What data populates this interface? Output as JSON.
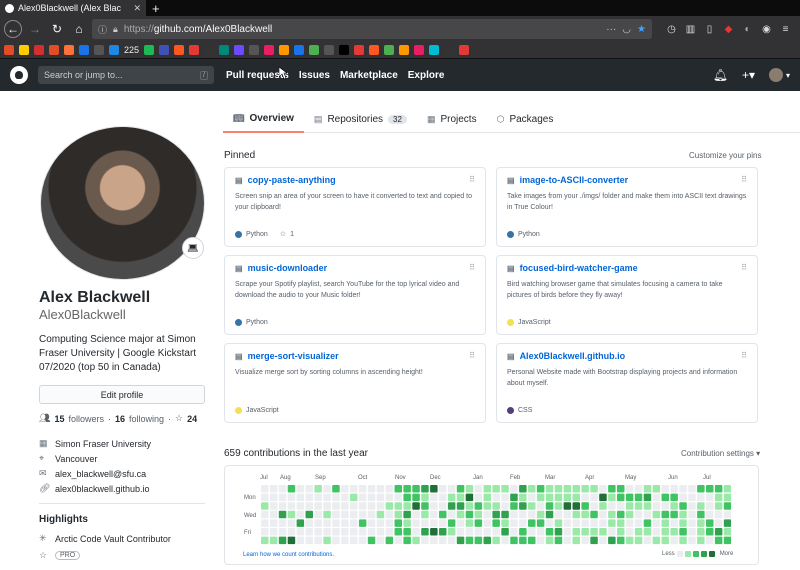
{
  "browser": {
    "tab_title": "Alex0Blackwell (Alex Blac",
    "url_scheme": "https://",
    "url_rest": "github.com/Alex0Blackwell",
    "bookmark_count": "225",
    "bookmark_colors": [
      "#e34c26",
      "#ffcc00",
      "#d32f2f",
      "#e34c26",
      "#ff7139",
      "#1a73e8",
      "#555",
      "#1e88e5",
      "#1db954",
      "#3f51b5",
      "#ff5722",
      "#e53935",
      "#333",
      "#00897b",
      "#6d4aff",
      "#555",
      "#e91e63",
      "#ff9800",
      "#1a73e8",
      "#4caf50",
      "#555",
      "#000",
      "#e53935",
      "#ff5722",
      "#4caf50",
      "#ff9800",
      "#e91e63",
      "#00bcd4",
      "#333",
      "#e53935"
    ]
  },
  "gh": {
    "search_placeholder": "Search or jump to...",
    "slash": "/",
    "nav": [
      "Pull requests",
      "Issues",
      "Marketplace",
      "Explore"
    ]
  },
  "tabs": {
    "overview": "Overview",
    "repositories": "Repositories",
    "repo_count": "32",
    "projects": "Projects",
    "packages": "Packages"
  },
  "profile": {
    "name": "Alex Blackwell",
    "username": "Alex0Blackwell",
    "bio": "Computing Science major at Simon Fraser University | Google Kickstart 07/2020 (top 50 in Canada)",
    "edit_label": "Edit profile",
    "followers": "15",
    "followers_label": "followers",
    "following": "16",
    "following_label": "following",
    "stars": "24",
    "org": "Simon Fraser University",
    "location": "Vancouver",
    "email": "alex_blackwell@sfu.ca",
    "website": "alex0blackwell.github.io",
    "highlights_title": "Highlights",
    "highlight1": "Arctic Code Vault Contributor",
    "highlight2": "PRO"
  },
  "pinned": {
    "title": "Pinned",
    "customize": "Customize your pins",
    "cards": [
      {
        "name": "copy-paste-anything",
        "desc": "Screen snip an area of your screen to have it converted to text and copied to your clipboard!",
        "lang": "Python",
        "color": "#3572A5",
        "stars": "1"
      },
      {
        "name": "image-to-ASCII-converter",
        "desc": "Take images from your ./imgs/ folder and make them into ASCII text drawings in True Colour!",
        "lang": "Python",
        "color": "#3572A5",
        "stars": ""
      },
      {
        "name": "music-downloader",
        "desc": "Scrape your Spotify playlist, search YouTube for the top lyrical video and download the audio to your Music folder!",
        "lang": "Python",
        "color": "#3572A5",
        "stars": ""
      },
      {
        "name": "focused-bird-watcher-game",
        "desc": "Bird watching browser game that simulates focusing a camera to take pictures of birds before they fly away!",
        "lang": "JavaScript",
        "color": "#f1e05a",
        "stars": ""
      },
      {
        "name": "merge-sort-visualizer",
        "desc": "Visualize merge sort by sorting columns in ascending height!",
        "lang": "JavaScript",
        "color": "#f1e05a",
        "stars": ""
      },
      {
        "name": "Alex0Blackwell.github.io",
        "desc": "Personal Website made with Bootstrap displaying projects and information about myself.",
        "lang": "CSS",
        "color": "#563d7c",
        "stars": ""
      }
    ]
  },
  "contrib": {
    "title": "659 contributions in the last year",
    "settings": "Contribution settings",
    "months": [
      "Jul",
      "Aug",
      "Sep",
      "Oct",
      "Nov",
      "Dec",
      "Jan",
      "Feb",
      "Mar",
      "Apr",
      "May",
      "Jun",
      "Jul"
    ],
    "days": [
      "Mon",
      "Wed",
      "Fri"
    ],
    "learn": "Learn how we count contributions.",
    "less": "Less",
    "more": "More",
    "levels": [
      "#ebedf0",
      "#9be9a8",
      "#40c463",
      "#30a14e",
      "#216e39"
    ]
  }
}
